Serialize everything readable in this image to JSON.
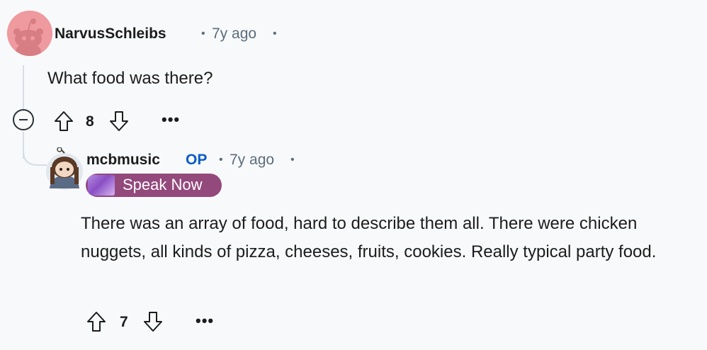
{
  "comments": [
    {
      "author": "NarvusSchleibs",
      "time": "7y ago",
      "separator": "•",
      "body": "What food was there?",
      "votes": "8",
      "more_label": "•••"
    },
    {
      "author": "mcbmusic",
      "op_badge": "OP",
      "time": "7y ago",
      "separator": "•",
      "flair": "Speak Now",
      "body": "There was an array of food, hard to describe them all. There were chicken nuggets, all kinds of pizza, cheeses, fruits, cookies. Really typical party food.",
      "votes": "7",
      "more_label": "•••"
    }
  ]
}
